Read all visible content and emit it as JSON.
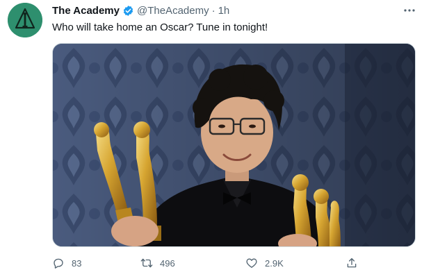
{
  "author": {
    "display_name": "The Academy",
    "handle": "@TheAcademy",
    "separator": "·",
    "time": "1h",
    "avatar_color": "#2e8f6e",
    "verified_color": "#1d9bf0"
  },
  "tweet": {
    "text": "Who will take home an Oscar? Tune in tonight!"
  },
  "media": {
    "icon": "photo"
  },
  "actions": {
    "reply_count": "83",
    "retweet_count": "496",
    "like_count": "2.9K"
  },
  "colors": {
    "secondary_text": "#536471",
    "primary_text": "#0f1419"
  }
}
